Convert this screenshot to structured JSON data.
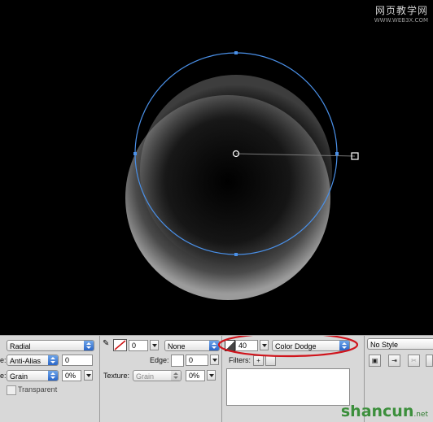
{
  "watermark_top": {
    "line1": "网页教学网",
    "line2": "WWW.WEB3X.COM"
  },
  "toolbar": {
    "fill_type": "Radial",
    "edge_mode": "Anti-Alias",
    "edge_value": "0",
    "texture_name": "Grain",
    "texture_percent": "0%",
    "transparent_label": "Transparent",
    "stroke_size": "0",
    "stroke_type": "None",
    "edge_label": "Edge:",
    "edge_field": "0",
    "texture_label": "Texture:",
    "stroke_texture": "Grain",
    "stroke_texture_percent": "0%",
    "opacity": "40",
    "blend_mode": "Color Dodge",
    "filters_label": "Filters:",
    "style": "No Style",
    "left_label_1": "e:",
    "left_label_2": "e:"
  },
  "watermark_bottom": {
    "text": "shancun",
    "suffix": ".net"
  },
  "colors": {
    "selection": "#4a90e8",
    "highlight_ring": "#d0141c"
  }
}
